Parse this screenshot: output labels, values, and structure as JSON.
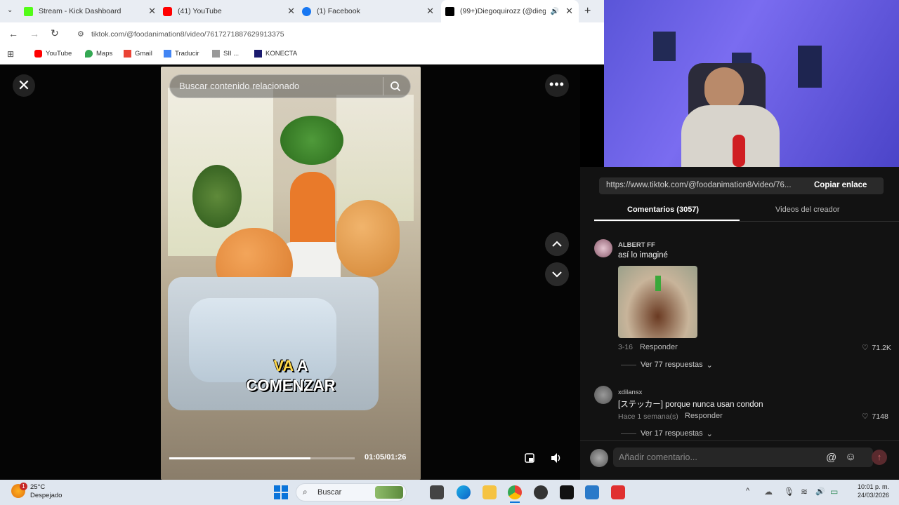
{
  "browser": {
    "tabs": [
      {
        "label": "Stream - Kick Dashboard",
        "color": "#53fc18"
      },
      {
        "label": "(41) YouTube",
        "color": "#ff0000"
      },
      {
        "label": "(1) Facebook",
        "color": "#1877f2"
      },
      {
        "label": "(99+)Diegoquirozz (@diego",
        "color": "#000000"
      }
    ],
    "url": "tiktok.com/@foodanimation8/video/7617271887629913375",
    "bookmarks": [
      "YouTube",
      "Maps",
      "Gmail",
      "Traducir",
      "SII ...",
      "KONECTA"
    ]
  },
  "video": {
    "search_placeholder": "Buscar contenido relacionado",
    "caption_line1_a": "VA",
    "caption_line1_b": " A",
    "caption_line2": "COMENZAR",
    "time": "01:05/01:26",
    "progress": 0.76
  },
  "comments_panel": {
    "link": "https://www.tiktok.com/@foodanimation8/video/76...",
    "copy_link_label": "Copiar enlace",
    "tab_comments": "Comentarios (3057)",
    "tab_videos": "Videos del creador",
    "comments": [
      {
        "user": "ALBERT FF",
        "text": "así lo imaginé",
        "date": "3-16",
        "reply_label": "Responder",
        "likes": "71.2K",
        "replies": "Ver 77 respuestas"
      },
      {
        "user": "xdilansx",
        "text": "[ステッカー] porque nunca usan condon",
        "date": "Hace 1 semana(s)",
        "reply_label": "Responder",
        "likes": "7148",
        "replies": "Ver 17 respuestas"
      }
    ],
    "input_placeholder": "Añadir comentario..."
  },
  "taskbar": {
    "weather_temp": "25°C",
    "weather_desc": "Despejado",
    "weather_badge": "1",
    "search_label": "Buscar",
    "time": "10:01 p. m.",
    "date": "24/03/2026"
  }
}
